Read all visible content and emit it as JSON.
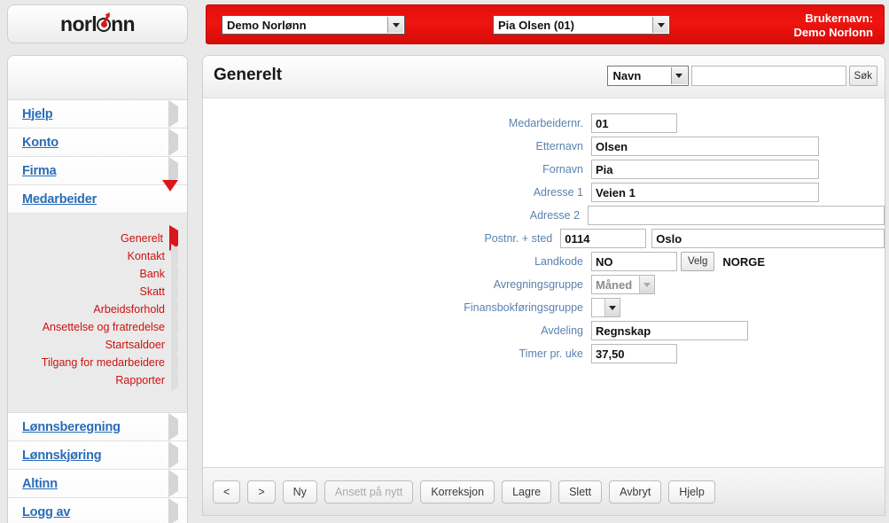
{
  "brand": {
    "logo_text_before": "norl",
    "logo_text_after": "nn",
    "logo_icon": "dart-target-icon"
  },
  "topbar": {
    "company": "Demo Norlønn",
    "employee": "Pia Olsen (01)",
    "user_label": "Brukernavn:",
    "user_name": "Demo Norlonn",
    "accent_color": "#e2100c"
  },
  "sidebar": {
    "items": [
      {
        "label": "Hjelp",
        "icon": "triangle-right-icon",
        "active": false
      },
      {
        "label": "Konto",
        "icon": "triangle-right-icon",
        "active": false
      },
      {
        "label": "Firma",
        "icon": "triangle-right-icon",
        "active": false
      },
      {
        "label": "Medarbeider",
        "icon": "triangle-down-icon",
        "active": true
      }
    ],
    "submenu": [
      {
        "label": "Generelt",
        "active": true
      },
      {
        "label": "Kontakt",
        "active": false
      },
      {
        "label": "Bank",
        "active": false
      },
      {
        "label": "Skatt",
        "active": false
      },
      {
        "label": "Arbeidsforhold",
        "active": false
      },
      {
        "label": "Ansettelse og fratredelse",
        "active": false
      },
      {
        "label": "Startsaldoer",
        "active": false
      },
      {
        "label": "Tilgang for medarbeidere",
        "active": false
      },
      {
        "label": "Rapporter",
        "active": false
      }
    ],
    "items_after": [
      {
        "label": "Lønnsberegning",
        "icon": "triangle-right-icon"
      },
      {
        "label": "Lønnskjøring",
        "icon": "triangle-right-icon"
      },
      {
        "label": "Altinn",
        "icon": "triangle-right-icon"
      },
      {
        "label": "Logg av",
        "icon": "triangle-right-icon"
      }
    ]
  },
  "main": {
    "title": "Generelt",
    "search": {
      "type": "Navn",
      "value": "",
      "placeholder": "",
      "button": "Søk"
    },
    "fields": {
      "medarbeidernr_label": "Medarbeidernr.",
      "medarbeidernr_value": "01",
      "etternavn_label": "Etternavn",
      "etternavn_value": "Olsen",
      "fornavn_label": "Fornavn",
      "fornavn_value": "Pia",
      "adresse1_label": "Adresse 1",
      "adresse1_value": "Veien 1",
      "adresse2_label": "Adresse 2",
      "adresse2_value": "",
      "postnr_label": "Postnr. + sted",
      "postnr_value": "0114",
      "sted_value": "Oslo",
      "landkode_label": "Landkode",
      "landkode_value": "NO",
      "landkode_button": "Velg",
      "landkode_text": "NORGE",
      "avregningsgruppe_label": "Avregningsgruppe",
      "avregningsgruppe_value": "Måned",
      "finansbokforingsgruppe_label": "Finansbokføringsgruppe",
      "finansbokforingsgruppe_value": "",
      "avdeling_label": "Avdeling",
      "avdeling_value": "Regnskap",
      "timer_label": "Timer pr. uke",
      "timer_value": "37,50"
    }
  },
  "footer": {
    "buttons": [
      {
        "label": "<",
        "disabled": false
      },
      {
        "label": ">",
        "disabled": false
      },
      {
        "label": "Ny",
        "disabled": false
      },
      {
        "label": "Ansett på nytt",
        "disabled": true
      },
      {
        "label": "Korreksjon",
        "disabled": false
      },
      {
        "label": "Lagre",
        "disabled": false
      },
      {
        "label": "Slett",
        "disabled": false
      },
      {
        "label": "Avbryt",
        "disabled": false
      },
      {
        "label": "Hjelp",
        "disabled": false
      }
    ]
  }
}
